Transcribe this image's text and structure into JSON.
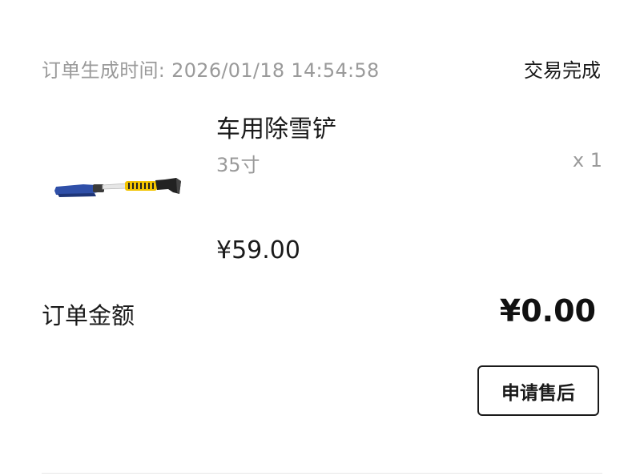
{
  "order": {
    "time_label": "订单生成时间:",
    "time_value": "2026/01/18 14:54:58",
    "status": "交易完成"
  },
  "product": {
    "name": "车用除雪铲",
    "spec": "35寸",
    "quantity": "x 1",
    "price": "¥59.00",
    "image_icon": "snow-shovel-image",
    "colors": {
      "brush": "#2f4fa8",
      "shaft": "#e8e8e8",
      "grip": "#f2c400",
      "scraper": "#222222"
    }
  },
  "total": {
    "label": "订单金额",
    "amount": "¥0.00"
  },
  "actions": {
    "after_sale_label": "申请售后"
  }
}
